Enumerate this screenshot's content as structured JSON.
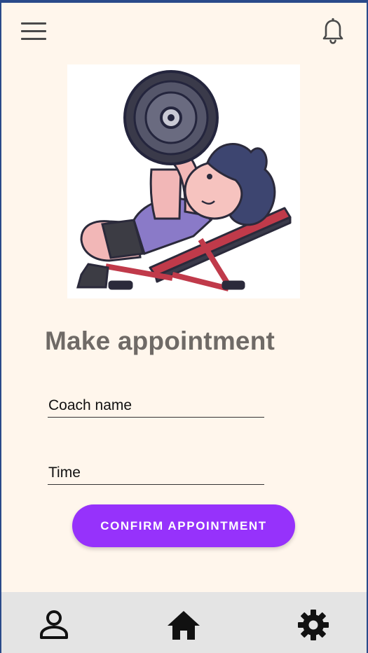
{
  "header": {
    "menu_icon": "hamburger-menu-icon",
    "notification_icon": "bell-icon"
  },
  "hero": {
    "illustration": "man-bench-pressing-barbell-cartoon"
  },
  "form": {
    "title": "Make appointment",
    "coach_placeholder": "Coach name",
    "time_placeholder": "Time",
    "confirm_label": "CONFIRM APPOINTMENT"
  },
  "bottom_nav": {
    "items": [
      {
        "icon": "profile-icon"
      },
      {
        "icon": "home-icon"
      },
      {
        "icon": "gear-icon"
      }
    ]
  },
  "colors": {
    "background": "#fff6ec",
    "accent": "#9632fb",
    "title": "#6f6a66",
    "nav_background": "#e4e4e4"
  }
}
